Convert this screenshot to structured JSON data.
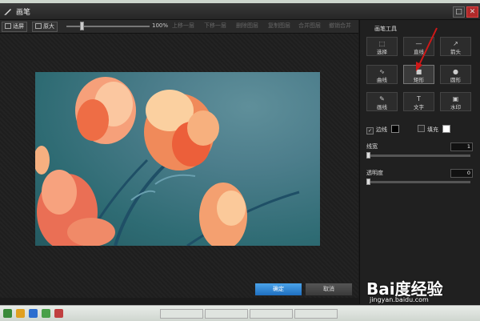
{
  "window": {
    "title": "画笔"
  },
  "toolbar": {
    "fit_label": "适屏",
    "original_label": "原大",
    "zoom_value": "100%",
    "zoom_level": 0.2,
    "undo": "上移一层",
    "redo": "下移一层",
    "delete_layer": "删除图层",
    "copy_layer": "复制图层",
    "merge_layer": "合并图层",
    "undo_merge": "撤销合并"
  },
  "panel": {
    "title": "画笔工具",
    "tools": [
      {
        "label": "选择",
        "icon": "select-icon"
      },
      {
        "label": "直线",
        "icon": "line-icon"
      },
      {
        "label": "箭头",
        "icon": "arrow-icon"
      },
      {
        "label": "曲线",
        "icon": "curve-icon"
      },
      {
        "label": "矩形",
        "icon": "rectangle-icon",
        "active": true
      },
      {
        "label": "圆形",
        "icon": "circle-icon"
      },
      {
        "label": "画线",
        "icon": "brush-icon"
      },
      {
        "label": "文字",
        "icon": "text-icon"
      },
      {
        "label": "水印",
        "icon": "stamp-icon"
      }
    ],
    "border_label": "边线",
    "border_checked": true,
    "border_color": "#000000",
    "fill_label": "填充",
    "fill_checked": false,
    "fill_color": "#ffffff",
    "width_label": "线宽",
    "width_value": "1",
    "opacity_label": "透明度",
    "opacity_value": "0"
  },
  "actions": {
    "confirm": "确定",
    "cancel": "取消"
  },
  "watermark": {
    "logo": "Bai度经验",
    "url": "jingyan.baidu.com"
  },
  "colors": {
    "accent": "#2b82d9",
    "close": "#b12a2a",
    "annotation_arrow": "#d01818"
  }
}
